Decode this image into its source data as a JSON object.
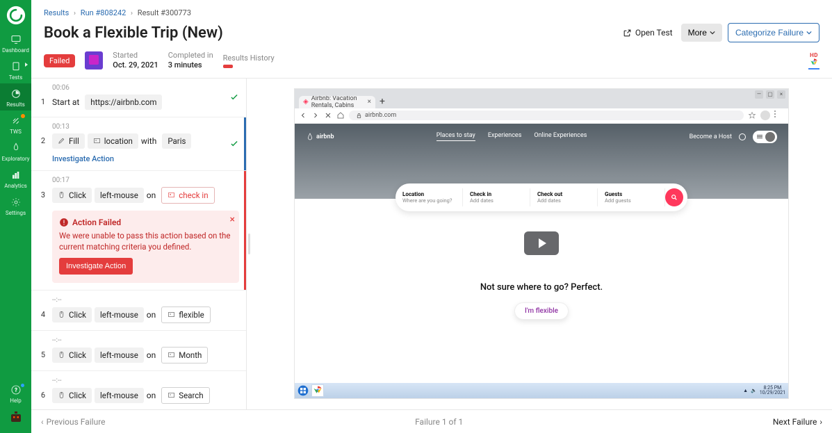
{
  "nav": {
    "items": [
      {
        "label": "Dashboard"
      },
      {
        "label": "Tests"
      },
      {
        "label": "Results"
      },
      {
        "label": "TWS"
      },
      {
        "label": "Exploratory"
      },
      {
        "label": "Analytics"
      },
      {
        "label": "Settings"
      }
    ],
    "help_label": "Help"
  },
  "breadcrumb": {
    "a_label": "Results",
    "b_label": "Run #808242",
    "c_label": "Result #300773"
  },
  "page": {
    "title": "Book a Flexible Trip (New)",
    "open_test_label": "Open Test",
    "more_label": "More",
    "cat_label": "Categorize Failure",
    "status": "Failed",
    "started_label": "Started",
    "started_value": "Oct. 29, 2021",
    "completed_label": "Completed in",
    "completed_value": "3 minutes",
    "history_label": "Results History",
    "hd_badge": "HD"
  },
  "steps": [
    {
      "state": "pass",
      "num": "1",
      "time": "00:06",
      "label": "Start at",
      "url": "https://airbnb.com"
    },
    {
      "state": "active",
      "num": "2",
      "time": "00:13",
      "action": "Fill",
      "target": "location",
      "with": "with",
      "value": "Paris",
      "investigate": "Investigate Action"
    },
    {
      "state": "fail",
      "num": "3",
      "time": "00:17",
      "action": "Click",
      "target": "left-mouse",
      "on": "on",
      "value": "check in",
      "failbox": {
        "title": "Action Failed",
        "text": "We were unable to pass this action based on the current matching criteria you defined.",
        "btn": "Investigate Action"
      }
    },
    {
      "state": "none",
      "num": "4",
      "time": "--:--",
      "action": "Click",
      "target": "left-mouse",
      "on": "on",
      "value": "flexible"
    },
    {
      "state": "none",
      "num": "5",
      "time": "--:--",
      "action": "Click",
      "target": "left-mouse",
      "on": "on",
      "value": "Month"
    },
    {
      "state": "none",
      "num": "6",
      "time": "--:--",
      "action": "Click",
      "target": "left-mouse",
      "on": "on",
      "value": "Search"
    }
  ],
  "preview": {
    "tab_title": "Airbnb: Vacation Rentals, Cabins",
    "url": "airbnb.com",
    "hero": {
      "logo": "airbnb",
      "menu": [
        "Places to stay",
        "Experiences",
        "Online Experiences"
      ],
      "become": "Become a Host"
    },
    "search": {
      "loc_label": "Location",
      "loc_ph": "Where are you going?",
      "in_label": "Check in",
      "in_ph": "Add dates",
      "out_label": "Check out",
      "out_ph": "Add dates",
      "g_label": "Guests",
      "g_ph": "Add guests"
    },
    "below": {
      "question": "Not sure where to go? Perfect.",
      "flex": "I'm flexible"
    },
    "taskbar": {
      "time": "8:25 PM",
      "date": "10/29/2021"
    }
  },
  "footer": {
    "prev": "Previous Failure",
    "count": "Failure 1 of 1",
    "next": "Next Failure"
  }
}
